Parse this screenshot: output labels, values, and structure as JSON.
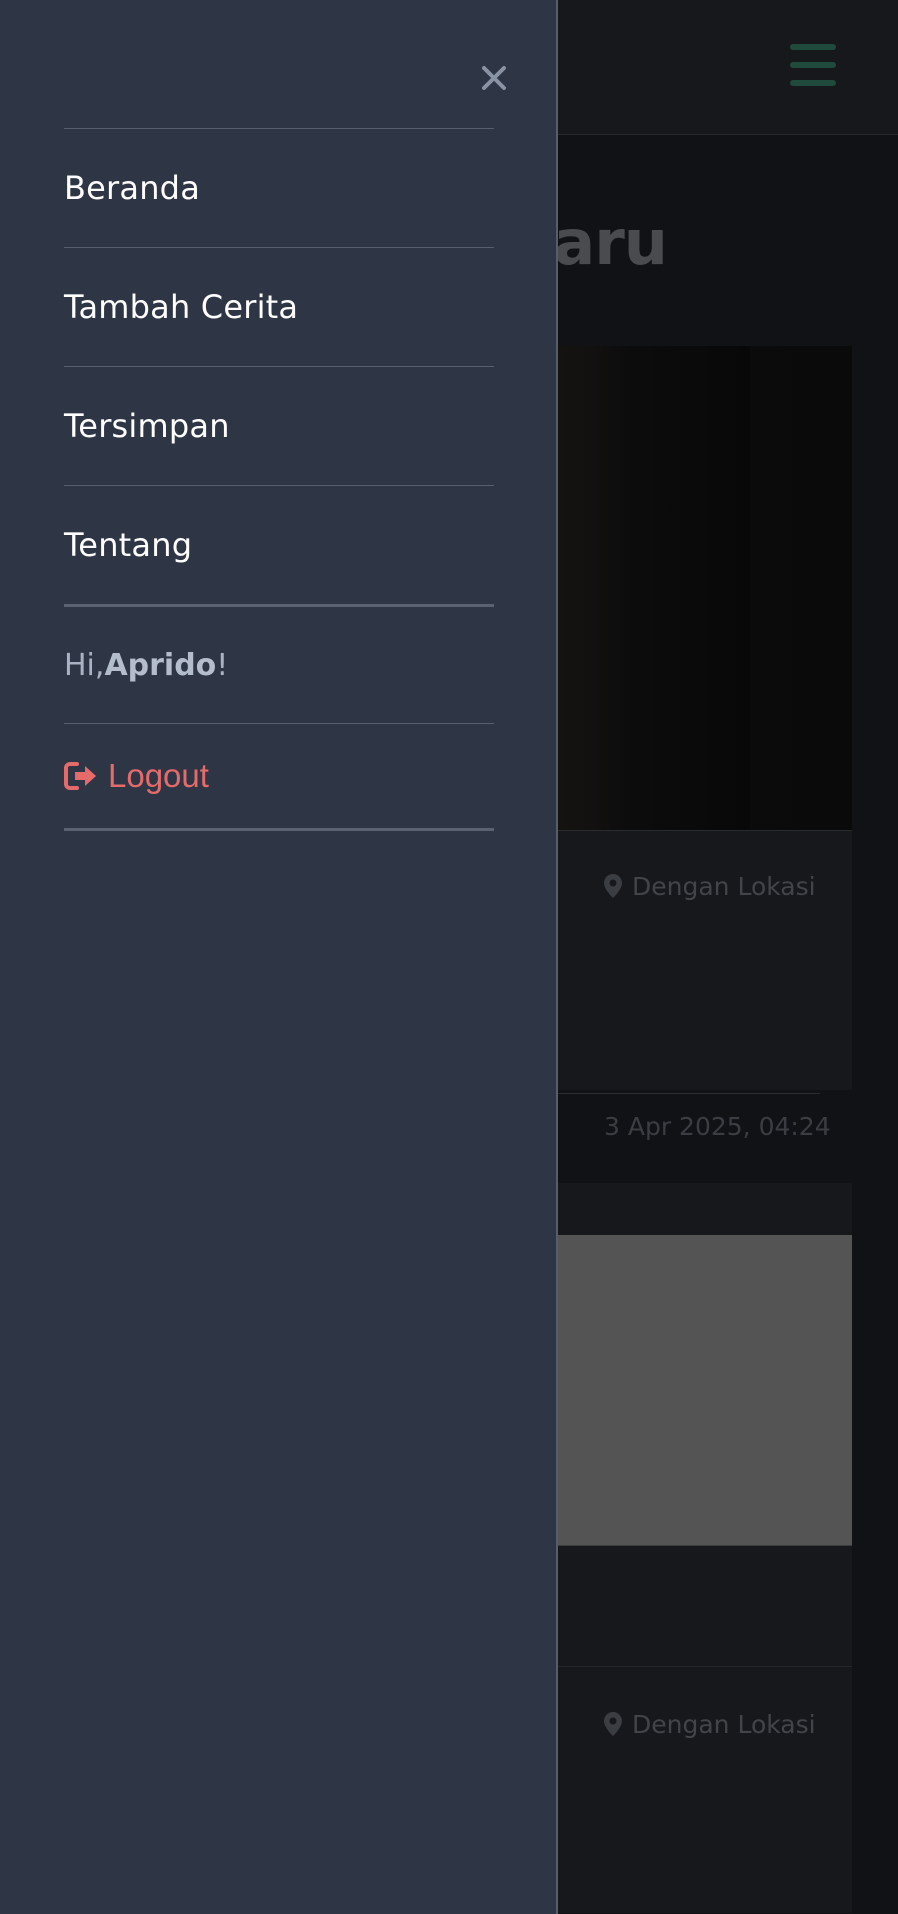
{
  "background": {
    "page_heading_fragment": "baru",
    "cards": [
      {
        "location_label": "Dengan Lokasi",
        "timestamp": "3 Apr 2025, 04:24"
      },
      {
        "location_label": "Dengan Lokasi"
      }
    ]
  },
  "drawer": {
    "close_icon": "close-icon",
    "nav_items": [
      {
        "label": "Beranda"
      },
      {
        "label": "Tambah Cerita"
      },
      {
        "label": "Tersimpan"
      },
      {
        "label": "Tentang"
      }
    ],
    "greeting": {
      "prefix": "Hi, ",
      "username": "Aprido",
      "suffix": "!"
    },
    "logout": {
      "icon": "sign-out-icon",
      "label": "Logout"
    }
  },
  "colors": {
    "drawer_bg": "#2e3545",
    "logout": "#e56b6b",
    "hamburger_accent": "#1f4a3c"
  }
}
